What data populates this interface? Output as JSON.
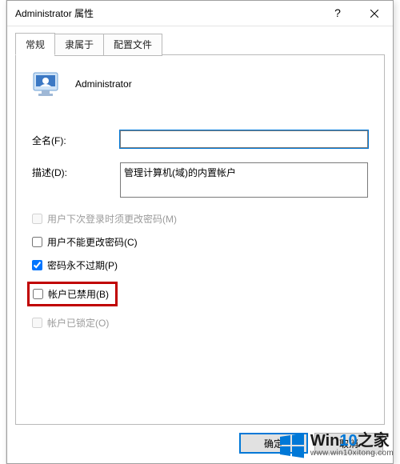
{
  "window": {
    "title": "Administrator 属性"
  },
  "tabs": {
    "general": "常规",
    "memberOf": "隶属于",
    "profile": "配置文件"
  },
  "user": {
    "display_name": "Administrator"
  },
  "fields": {
    "fullname_label": "全名(F):",
    "fullname_value": "",
    "description_label": "描述(D):",
    "description_value": "管理计算机(域)的内置帐户"
  },
  "checks": {
    "must_change_label": "用户下次登录时须更改密码(M)",
    "must_change_checked": false,
    "must_change_enabled": false,
    "cant_change_label": "用户不能更改密码(C)",
    "cant_change_checked": false,
    "cant_change_enabled": true,
    "never_expire_label": "密码永不过期(P)",
    "never_expire_checked": true,
    "never_expire_enabled": true,
    "disabled_label": "帐户已禁用(B)",
    "disabled_checked": false,
    "disabled_enabled": true,
    "locked_label": "帐户已锁定(O)",
    "locked_checked": false,
    "locked_enabled": false
  },
  "buttons": {
    "ok": "确定",
    "cancel": "取消"
  },
  "watermark": {
    "brand_prefix": "Win",
    "brand_ten": "10",
    "brand_suffix": "之家",
    "url": "www.win10xitong.com"
  }
}
